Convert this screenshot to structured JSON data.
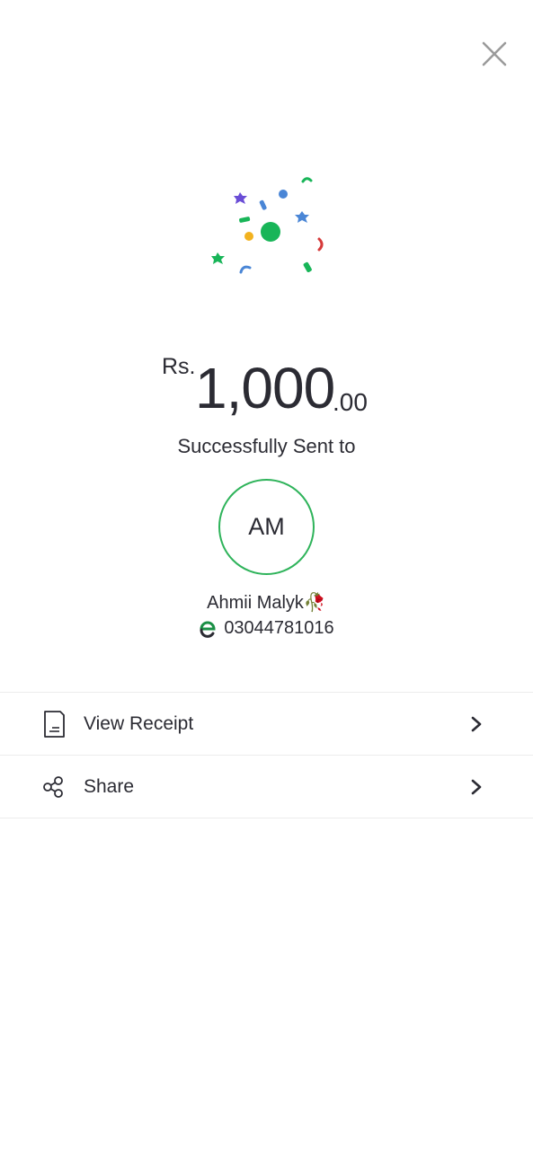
{
  "header": {
    "close_icon": "close-icon"
  },
  "success": {
    "currency": "Rs.",
    "amount": "1,000",
    "decimals": ".00",
    "message": "Successfully Sent to"
  },
  "recipient": {
    "initials": "AM",
    "name": "Ahmii Malyk🥀",
    "number": "03044781016",
    "network_icon": "network-logo-icon",
    "avatar_ring_color": "#2eb35a"
  },
  "actions": [
    {
      "label": "View Receipt",
      "icon": "receipt-icon"
    },
    {
      "label": "Share",
      "icon": "share-icon"
    }
  ],
  "colors": {
    "accent": "#2eb35a",
    "text": "#2b2b33",
    "divider": "#ececec"
  }
}
